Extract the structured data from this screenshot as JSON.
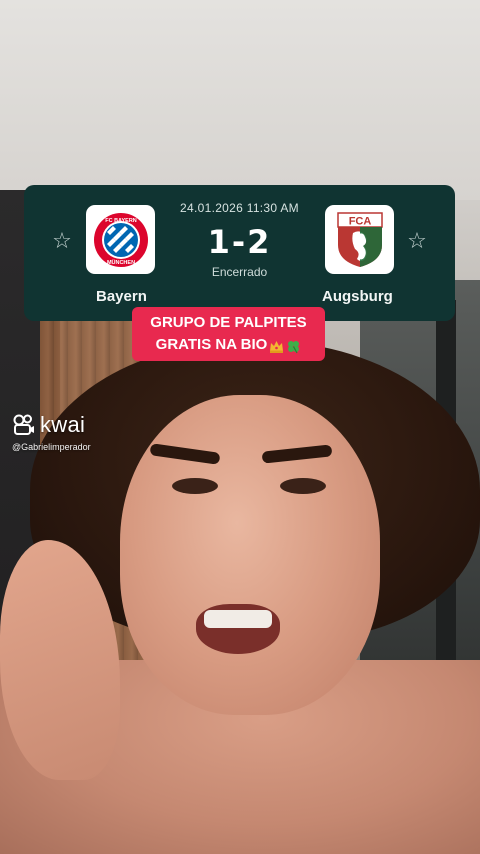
{
  "scoreboard": {
    "datetime": "24.01.2026 11:30 AM",
    "score": "1-2",
    "status": "Encerrado",
    "home_team": {
      "name": "Bayern",
      "crest_icon": "bayern-munchen-crest",
      "crest_text": "FC BAYERN MÜNCHEN"
    },
    "away_team": {
      "name": "Augsburg",
      "crest_icon": "fc-augsburg-crest",
      "crest_text": "FCA"
    },
    "favorite_icon": "star-outline-icon",
    "colors": {
      "card_bg": "#103432",
      "crest_bg": "#ffffff"
    }
  },
  "promo": {
    "line1": "GRUPO DE PALPITES",
    "line2": "GRATIS NA BIO",
    "emojis": [
      "crown-icon",
      "four-leaf-clover-icon"
    ],
    "bg_color": "#e8294f"
  },
  "watermark": {
    "brand": "kwai",
    "handle": "@Gabrielimperador"
  }
}
